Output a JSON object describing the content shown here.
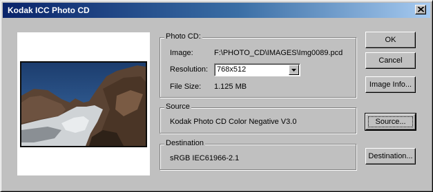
{
  "window": {
    "title": "Kodak ICC Photo CD"
  },
  "photo_cd": {
    "group_label": "Photo CD:",
    "image_label": "Image:",
    "image_value": "F:\\PHOTO_CD\\IMAGES\\Img0089.pcd",
    "resolution_label": "Resolution:",
    "resolution_value": "768x512",
    "file_size_label": "File Size:",
    "file_size_value": "1.125 MB"
  },
  "source": {
    "group_label": "Source",
    "value": "Kodak Photo CD Color Negative V3.0"
  },
  "destination": {
    "group_label": "Destination",
    "value": "sRGB IEC61966-2.1"
  },
  "buttons": {
    "ok": "OK",
    "cancel": "Cancel",
    "image_info": "Image Info...",
    "source": "Source...",
    "destination": "Destination..."
  },
  "icons": {
    "close": "close-icon",
    "dropdown": "chevron-down-icon"
  }
}
